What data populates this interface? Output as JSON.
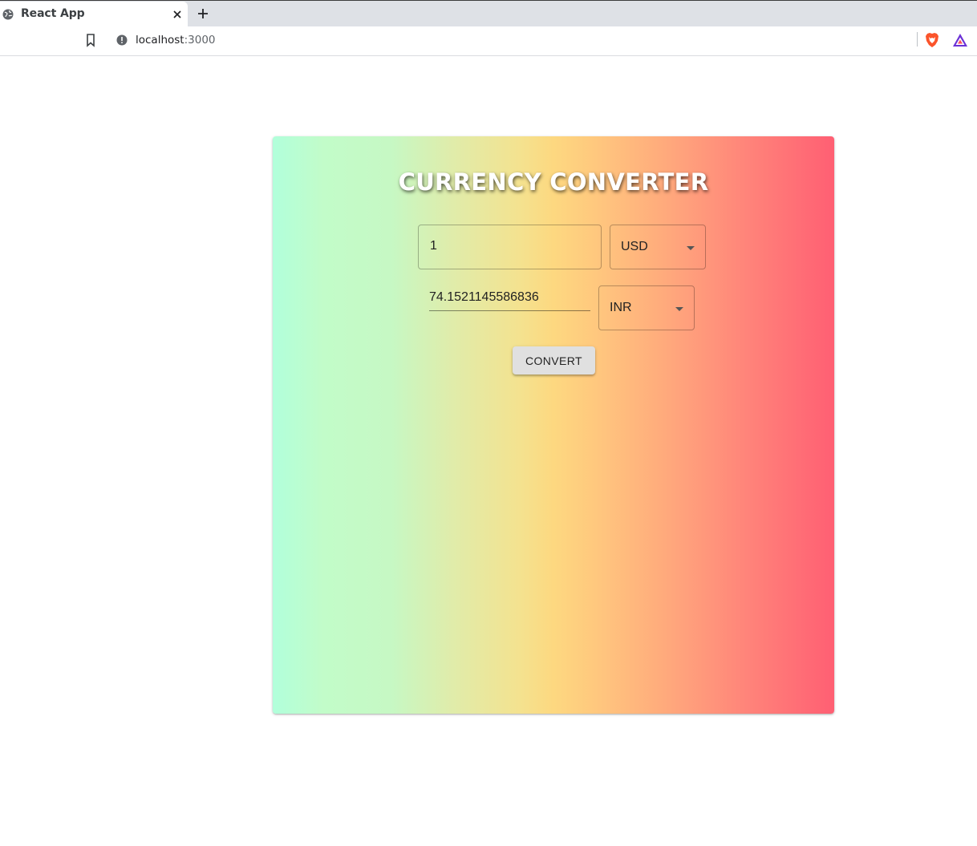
{
  "browser": {
    "tab_title": "React App",
    "url_host": "localhost",
    "url_port": ":3000"
  },
  "app": {
    "title": "CURRENCY CONVERTER",
    "amount_value": "1",
    "from_currency": "USD",
    "result_value": "74.1521145586836",
    "to_currency": "INR",
    "convert_label": "CONVERT"
  },
  "colors": {
    "gradient_left": "#b1ffdb",
    "gradient_middle": "#fdd880",
    "gradient_right": "#ff5f73",
    "button_bg": "#e0e0e0"
  },
  "icons": {
    "tab_favicon": "globe-icon",
    "tab_close": "close-icon",
    "new_tab": "plus-icon",
    "bookmark": "bookmark-icon",
    "site_info": "info-icon",
    "brave_shields": "brave-lion-icon",
    "brave_rewards": "triangle-icon",
    "select_caret": "caret-down-icon"
  }
}
